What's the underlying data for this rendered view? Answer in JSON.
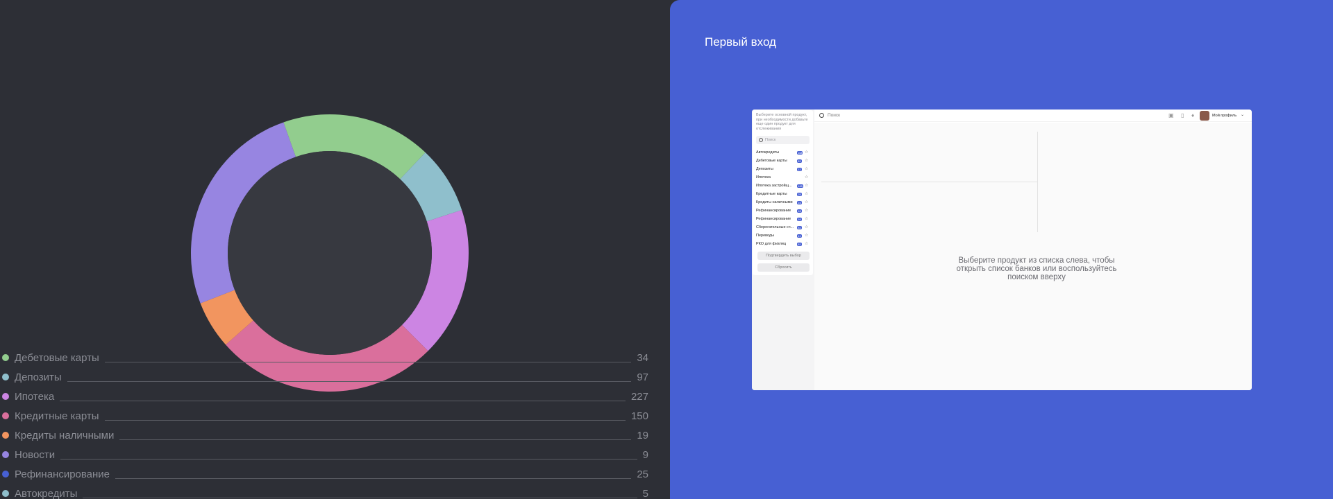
{
  "chart_data": {
    "type": "pie",
    "categories": [
      "Дебетовые карты",
      "Депозиты",
      "Ипотека",
      "Кредитные карты",
      "Кредиты наличными",
      "Новости",
      "Рефинансирование",
      "Автокредиты"
    ],
    "values": [
      34,
      97,
      227,
      150,
      19,
      9,
      25,
      5
    ],
    "title": "",
    "donut": true
  },
  "donut_segments": [
    {
      "name": "green",
      "color": "#92cd8e",
      "share": 0.175
    },
    {
      "name": "teal",
      "color": "#8fbfcc",
      "share": 0.079
    },
    {
      "name": "violet",
      "color": "#cc85e3",
      "share": 0.175
    },
    {
      "name": "pink",
      "color": "#da6f9c",
      "share": 0.26
    },
    {
      "name": "orange",
      "color": "#f2955f",
      "share": 0.056
    },
    {
      "name": "lavender",
      "color": "#9785e1",
      "share": 0.255
    }
  ],
  "legend": [
    {
      "label": "Дебетовые карты",
      "value": "34",
      "color": "#92cd8e"
    },
    {
      "label": "Депозиты",
      "value": "97",
      "color": "#8fbfcc"
    },
    {
      "label": "Ипотека",
      "value": "227",
      "color": "#cc85e3"
    },
    {
      "label": "Кредитные карты",
      "value": "150",
      "color": "#da6f9c"
    },
    {
      "label": "Кредиты наличными",
      "value": "19",
      "color": "#f2955f"
    },
    {
      "label": "Новости",
      "value": "9",
      "color": "#9785e1"
    },
    {
      "label": "Рефинансирование",
      "value": "25",
      "color": "#4760d3"
    },
    {
      "label": "Автокредиты",
      "value": "5",
      "color": "#8fbfcc"
    }
  ],
  "panel": {
    "title": "Первый вход"
  },
  "app": {
    "sidebar": {
      "hint": "Выберите основной продукт, при необходимости добавьте еще один продукт для отслеживания",
      "search_placeholder": "Поиск",
      "items": [
        {
          "label": "Автокредиты",
          "badge": "118"
        },
        {
          "label": "Дебетовые карты",
          "badge": "81"
        },
        {
          "label": "Депозиты",
          "badge": "12"
        },
        {
          "label": "Ипотека",
          "badge": ""
        },
        {
          "label": "Ипотека застройщ...",
          "badge": "148"
        },
        {
          "label": "Кредитные карты",
          "badge": "25"
        },
        {
          "label": "Кредиты наличными",
          "badge": "16"
        },
        {
          "label": "Рефинансирование",
          "badge": "16"
        },
        {
          "label": "Рефинансирование",
          "badge": "16"
        },
        {
          "label": "Сберегательные сч...",
          "badge": "81"
        },
        {
          "label": "Переводы",
          "badge": "41"
        },
        {
          "label": "РКО для физлиц",
          "badge": "81"
        }
      ],
      "confirm_label": "Подтвердить выбор",
      "reset_label": "Сбросить"
    },
    "topbar": {
      "search_placeholder": "Поиск",
      "profile_label": "Мой профиль"
    },
    "empty_message": "Выберите продукт из списка слева, чтобы открыть список банков или воспользуйтесь поиском вверху"
  }
}
